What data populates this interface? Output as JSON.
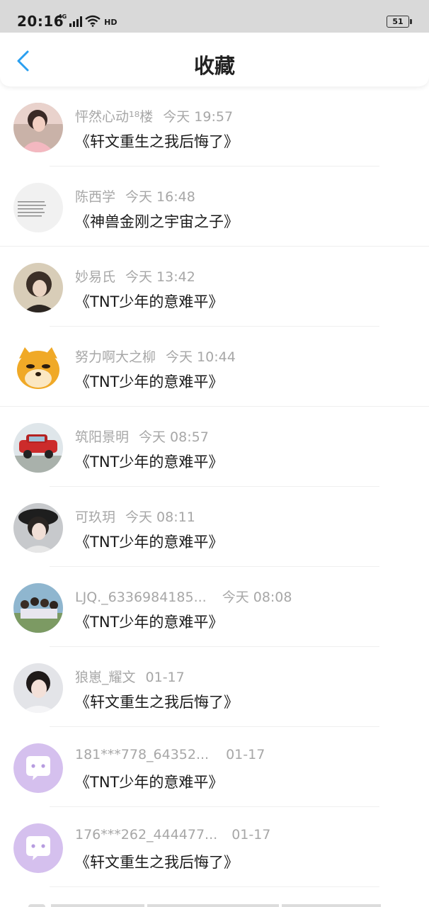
{
  "status_bar": {
    "time": "20:16",
    "network": "4G",
    "hd": "HD",
    "battery": "51"
  },
  "header": {
    "title": "收藏",
    "back_icon": "chevron-left-icon",
    "accent_color": "#2a9ff0"
  },
  "items": [
    {
      "author": "怦然心动¹⁸楼",
      "time": "今天 19:57",
      "title": "《轩文重生之我后悔了》"
    },
    {
      "author": "陈西学",
      "time": "今天 16:48",
      "title": "《神兽金刚之宇宙之子》"
    },
    {
      "author": "妙易氏",
      "time": "今天 13:42",
      "title": "《TNT少年的意难平》"
    },
    {
      "author": "努力啊大之柳",
      "time": "今天 10:44",
      "title": "《TNT少年的意难平》"
    },
    {
      "author": "筑阳景明",
      "time": "今天 08:57",
      "title": "《TNT少年的意难平》"
    },
    {
      "author": "可玖玥",
      "time": "今天 08:11",
      "title": "《TNT少年的意难平》"
    },
    {
      "author": "LJQ._6336984185...",
      "time": "今天 08:08",
      "title": "《TNT少年的意难平》"
    },
    {
      "author": "狼崽_耀文",
      "time": "01-17",
      "title": "《轩文重生之我后悔了》"
    },
    {
      "author": "181***778_64352...",
      "time": "01-17",
      "title": "《TNT少年的意难平》"
    },
    {
      "author": "176***262_444477...",
      "time": "01-17",
      "title": "《轩文重生之我后悔了》"
    }
  ]
}
